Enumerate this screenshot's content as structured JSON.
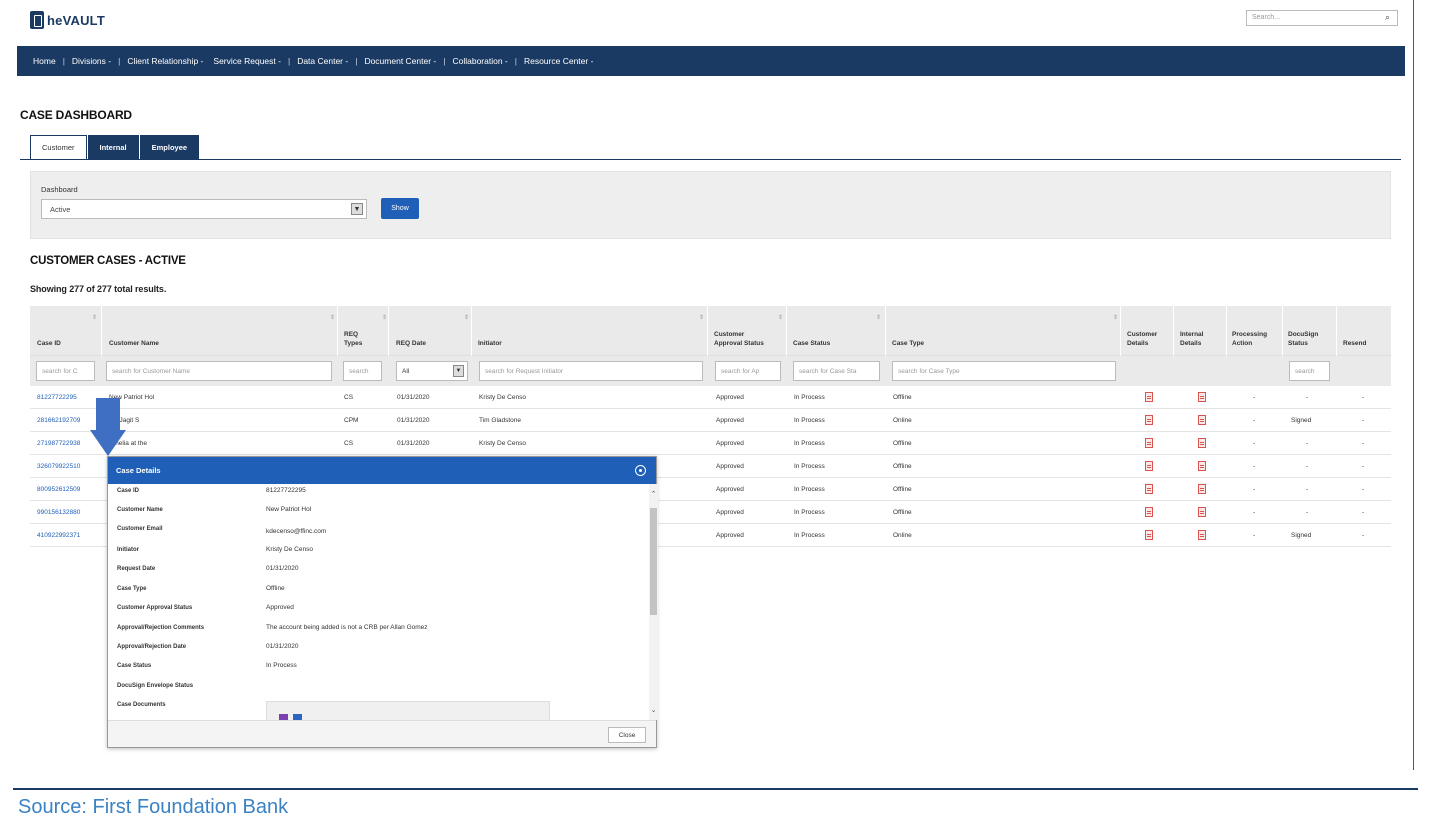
{
  "app": {
    "logo_text": "heVAULT",
    "search_placeholder": "Search..."
  },
  "nav": {
    "items": [
      "Home",
      "Divisions -",
      "Client Relationship -",
      "Service Request -",
      "Data Center -",
      "Document Center -",
      "Collaboration -",
      "Resource Center -"
    ],
    "separator": "|"
  },
  "page": {
    "title": "CASE DASHBOARD"
  },
  "tabs": [
    {
      "label": "Customer",
      "active": true
    },
    {
      "label": "Internal",
      "active": false
    },
    {
      "label": "Employee",
      "active": false
    }
  ],
  "filter": {
    "label": "Dashboard",
    "selected": "Active",
    "show_label": "Show"
  },
  "section": {
    "title": "CUSTOMER CASES - ACTIVE",
    "count_text": "Showing 277 of 277 total results."
  },
  "table": {
    "headers": [
      "Case ID",
      "Customer Name",
      "REQ Types",
      "REQ Date",
      "Initiator",
      "Customer Approval Status",
      "Case Status",
      "Case Type",
      "Customer Details",
      "Internal Details",
      "Processing Action",
      "DocuSign Status",
      "Resend"
    ],
    "filters": {
      "case_id": "search for C",
      "customer_name": "search for Customer Name",
      "req_types": "search",
      "req_date": "All",
      "initiator": "search for Request Initiator",
      "approval": "search for Ap",
      "case_status": "search for Case Sta",
      "case_type": "search for Case Type",
      "docusign": "search"
    },
    "rows": [
      {
        "case_id": "81227722295",
        "customer": "New Patriot Hol",
        "req_type": "CS",
        "req_date": "01/31/2020",
        "initiator": "Kristy De Censo",
        "approval": "Approved",
        "status": "In Process",
        "type": "Offline",
        "processing": "-",
        "docusign": "-",
        "resend": "-"
      },
      {
        "case_id": "281662192709",
        "customer": "aju Jagit S",
        "req_type": "CPM",
        "req_date": "01/31/2020",
        "initiator": "Tim Gladstone",
        "approval": "Approved",
        "status": "In Process",
        "type": "Online",
        "processing": "-",
        "docusign": "Signed",
        "resend": "-"
      },
      {
        "case_id": "271987722938",
        "customer": "Amelia at the",
        "req_type": "CS",
        "req_date": "01/31/2020",
        "initiator": "Kristy De Censo",
        "approval": "Approved",
        "status": "In Process",
        "type": "Offline",
        "processing": "-",
        "docusign": "-",
        "resend": "-"
      },
      {
        "case_id": "326079922510",
        "customer": "",
        "req_type": "",
        "req_date": "",
        "initiator": "",
        "approval": "Approved",
        "status": "In Process",
        "type": "Offline",
        "processing": "-",
        "docusign": "-",
        "resend": "-"
      },
      {
        "case_id": "800952612509",
        "customer": "",
        "req_type": "",
        "req_date": "",
        "initiator": "",
        "approval": "Approved",
        "status": "In Process",
        "type": "Offline",
        "processing": "-",
        "docusign": "-",
        "resend": "-"
      },
      {
        "case_id": "990156132880",
        "customer": "",
        "req_type": "",
        "req_date": "",
        "initiator": "",
        "approval": "Approved",
        "status": "In Process",
        "type": "Offline",
        "processing": "-",
        "docusign": "-",
        "resend": "-"
      },
      {
        "case_id": "410922992371",
        "customer": "",
        "req_type": "",
        "req_date": "",
        "initiator": "",
        "approval": "Approved",
        "status": "In Process",
        "type": "Online",
        "processing": "-",
        "docusign": "Signed",
        "resend": "-"
      }
    ]
  },
  "modal": {
    "title": "Case Details",
    "fields": [
      {
        "label": "Case ID",
        "value": "81227722295"
      },
      {
        "label": "Customer Name",
        "value": "New Patriot Hol"
      },
      {
        "label": "Customer Email",
        "value": "kdecenso@ffinc.com"
      },
      {
        "label": "Initiator",
        "value": "Kristy De Censo"
      },
      {
        "label": "Request Date",
        "value": "01/31/2020"
      },
      {
        "label": "Case Type",
        "value": "Offline"
      },
      {
        "label": "Customer Approval Status",
        "value": "Approved"
      },
      {
        "label": "Approval/Rejection Comments",
        "value": "The account being added is not a CRB per Allan Gomez"
      },
      {
        "label": "Approval/Rejection Date",
        "value": "01/31/2020"
      },
      {
        "label": "Case Status",
        "value": "In Process"
      },
      {
        "label": "DocuSign Envelope Status",
        "value": ""
      },
      {
        "label": "Case Documents",
        "value": ""
      }
    ],
    "close_label": "Close"
  },
  "footer": {
    "source": "Source: First Foundation Bank"
  },
  "colors": {
    "navy": "#1b3a63",
    "accent_blue": "#1f5fb8",
    "source_blue": "#3a82c4"
  }
}
